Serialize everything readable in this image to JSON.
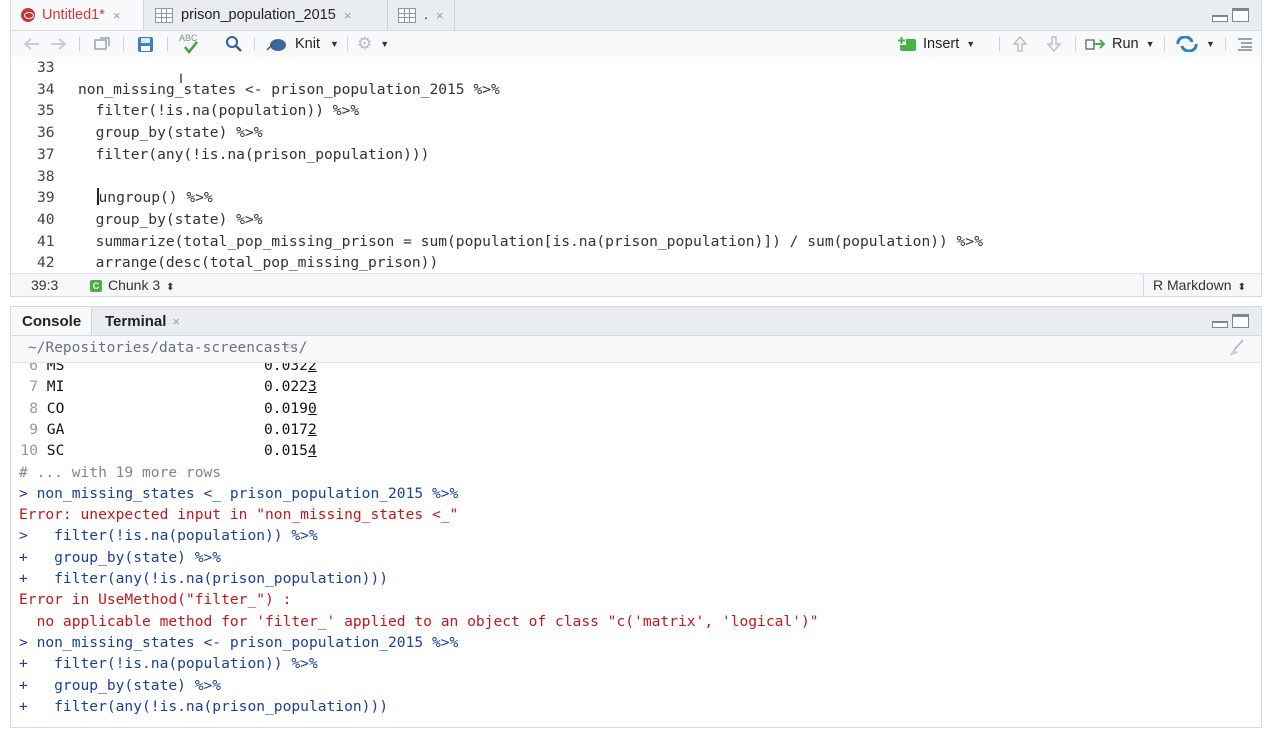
{
  "editor": {
    "tabs": [
      {
        "label": "Untitled1*",
        "icon": "r-document-icon",
        "close": "×"
      },
      {
        "label": "prison_population_2015",
        "icon": "data-grid-icon",
        "close": "×"
      },
      {
        "label": ".",
        "icon": "data-grid-icon",
        "close": "×"
      }
    ],
    "toolbar": {
      "knit_label": "Knit",
      "insert_label": "Insert",
      "run_label": "Run",
      "spellcheck_label": "ABC"
    },
    "code_lines": [
      {
        "num": "33",
        "text": ""
      },
      {
        "num": "34",
        "text": "non_missing_states <- prison_population_2015 %>%"
      },
      {
        "num": "35",
        "text": "  filter(!is.na(population)) %>%"
      },
      {
        "num": "36",
        "text": "  group_by(state) %>%"
      },
      {
        "num": "37",
        "text": "  filter(any(!is.na(prison_population)))"
      },
      {
        "num": "38",
        "text": ""
      },
      {
        "num": "39",
        "text": "ungroup() %>%"
      },
      {
        "num": "40",
        "text": "  group_by(state) %>%"
      },
      {
        "num": "41",
        "text": "  summarize(total_pop_missing_prison = sum(population[is.na(prison_population)]) / sum(population)) %>%"
      },
      {
        "num": "42",
        "text": "  arrange(desc(total_pop_missing_prison))"
      }
    ],
    "status": {
      "position": "39:3",
      "chunk_badge": "C",
      "chunk": "Chunk 3",
      "mode": "R Markdown"
    }
  },
  "console_pane": {
    "tabs": [
      {
        "label": "Console"
      },
      {
        "label": "Terminal",
        "close": "×"
      }
    ],
    "path": "~/Repositories/data-screencasts/"
  },
  "console_rows": [
    {
      "n": "6",
      "state": "MS",
      "value": "0.032",
      "last": "2"
    },
    {
      "n": "7",
      "state": "MI",
      "value": "0.022",
      "last": "3"
    },
    {
      "n": "8",
      "state": "CO",
      "value": "0.019",
      "last": "0"
    },
    {
      "n": "9",
      "state": "GA",
      "value": "0.017",
      "last": "2"
    },
    {
      "n": "10",
      "state": "SC",
      "value": "0.015",
      "last": "4"
    }
  ],
  "console_lines": [
    {
      "kind": "cmt",
      "text": "# ... with 19 more rows"
    },
    {
      "kind": "inp",
      "text": "> non_missing_states <_ prison_population_2015 %>%"
    },
    {
      "kind": "err",
      "text": "Error: unexpected input in \"non_missing_states <_\""
    },
    {
      "kind": "inp",
      "text": ">   filter(!is.na(population)) %>%"
    },
    {
      "kind": "inp",
      "text": "+   group_by(state) %>%"
    },
    {
      "kind": "inp",
      "text": "+   filter(any(!is.na(prison_population)))"
    },
    {
      "kind": "err",
      "text": "Error in UseMethod(\"filter_\") :"
    },
    {
      "kind": "err",
      "text": "  no applicable method for 'filter_' applied to an object of class \"c('matrix', 'logical')\""
    },
    {
      "kind": "inp",
      "text": "> non_missing_states <- prison_population_2015 %>%"
    },
    {
      "kind": "inp",
      "text": "+   filter(!is.na(population)) %>%"
    },
    {
      "kind": "inp",
      "text": "+   group_by(state) %>%"
    },
    {
      "kind": "inp",
      "text": "+   filter(any(!is.na(prison_population)))"
    }
  ],
  "colors": {
    "active_tab_text": "#d1383b",
    "console_input": "#1c3e9c",
    "console_error": "#c4161c",
    "chunk_badge": "#49b045"
  }
}
